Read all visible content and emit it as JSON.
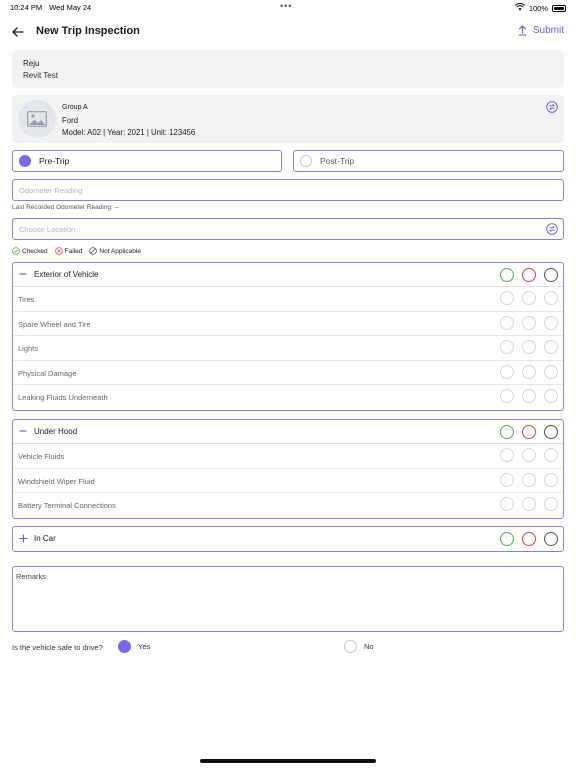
{
  "status": {
    "time": "10:24 PM",
    "date": "Wed May 24",
    "battery": "100%"
  },
  "nav": {
    "title": "New Trip Inspection",
    "submit_label": "Submit"
  },
  "user": {
    "name": "Reju",
    "subtitle": "Revit Test"
  },
  "vehicle": {
    "group": "Group A",
    "make": "Ford",
    "details": "Model: A02 | Year: 2021 | Unit: 123456"
  },
  "trip_type": {
    "pre_label": "Pre-Trip",
    "post_label": "Post-Trip",
    "selected": "Pre-Trip"
  },
  "odometer": {
    "placeholder": "Odometer Reading",
    "hint": "Last Recorded Odometer Reading: --"
  },
  "location": {
    "placeholder": "Choose Location"
  },
  "legend": {
    "checked": "Checked",
    "failed": "Failed",
    "na": "Not Applicable"
  },
  "colors": {
    "accent": "#7b68e6",
    "checked": "#4caf50",
    "failed": "#d04848",
    "na": "#555555"
  },
  "sections": [
    {
      "title": "Exterior of Vehicle",
      "expanded": true,
      "items": [
        "Tires",
        "Spare Wheel and Tire",
        "Lights",
        "Physical Damage",
        "Leaking Fluids Underneath"
      ]
    },
    {
      "title": "Under Hood",
      "expanded": true,
      "items": [
        "Vehicle Fluids",
        "Windshield Wiper Fluid",
        "Battery Terminal Connections"
      ]
    },
    {
      "title": "In Car",
      "expanded": false,
      "items": []
    }
  ],
  "remarks": {
    "placeholder": "Remarks"
  },
  "safety": {
    "question": "Is the vehicle safe to drive?",
    "yes": "Yes",
    "no": "No",
    "selected": "Yes"
  }
}
